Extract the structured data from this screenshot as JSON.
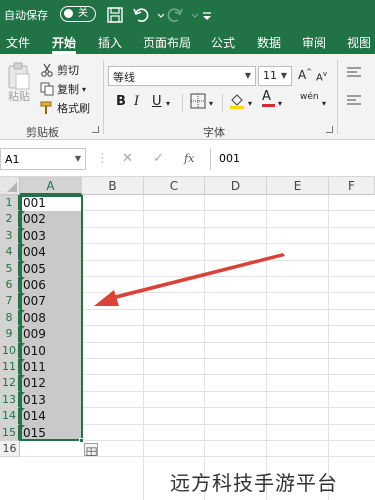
{
  "titlebar": {
    "autosave_label": "自动保存",
    "autosave_state": "关",
    "icons": [
      "save-icon",
      "undo-icon",
      "redo-icon",
      "customize-qat-icon"
    ]
  },
  "tabs": [
    "文件",
    "开始",
    "插入",
    "页面布局",
    "公式",
    "数据",
    "审阅",
    "视图"
  ],
  "active_tab": "开始",
  "ribbon": {
    "clipboard": {
      "paste": "粘贴",
      "cut": "剪切",
      "copy": "复制",
      "format_painter": "格式刷",
      "group_label": "剪贴板"
    },
    "font": {
      "font_name": "等线",
      "font_size": "11",
      "bold": "B",
      "italic": "I",
      "underline": "U",
      "wen": "wén",
      "group_label": "字体"
    }
  },
  "formula_bar": {
    "name_box": "A1",
    "fx": "fx",
    "value": "001"
  },
  "columns": [
    "A",
    "B",
    "C",
    "D",
    "E",
    "F"
  ],
  "rows": [
    "1",
    "2",
    "3",
    "4",
    "5",
    "6",
    "7",
    "8",
    "9",
    "10",
    "11",
    "12",
    "13",
    "14",
    "15",
    "16"
  ],
  "cells": [
    "001",
    "002",
    "003",
    "004",
    "005",
    "006",
    "007",
    "008",
    "009",
    "010",
    "011",
    "012",
    "013",
    "014",
    "015"
  ],
  "watermark": "远方科技手游平台",
  "colors": {
    "excel_green": "#217346",
    "selection_fill": "#c9c9c9",
    "arrow_red": "#d9423a"
  }
}
